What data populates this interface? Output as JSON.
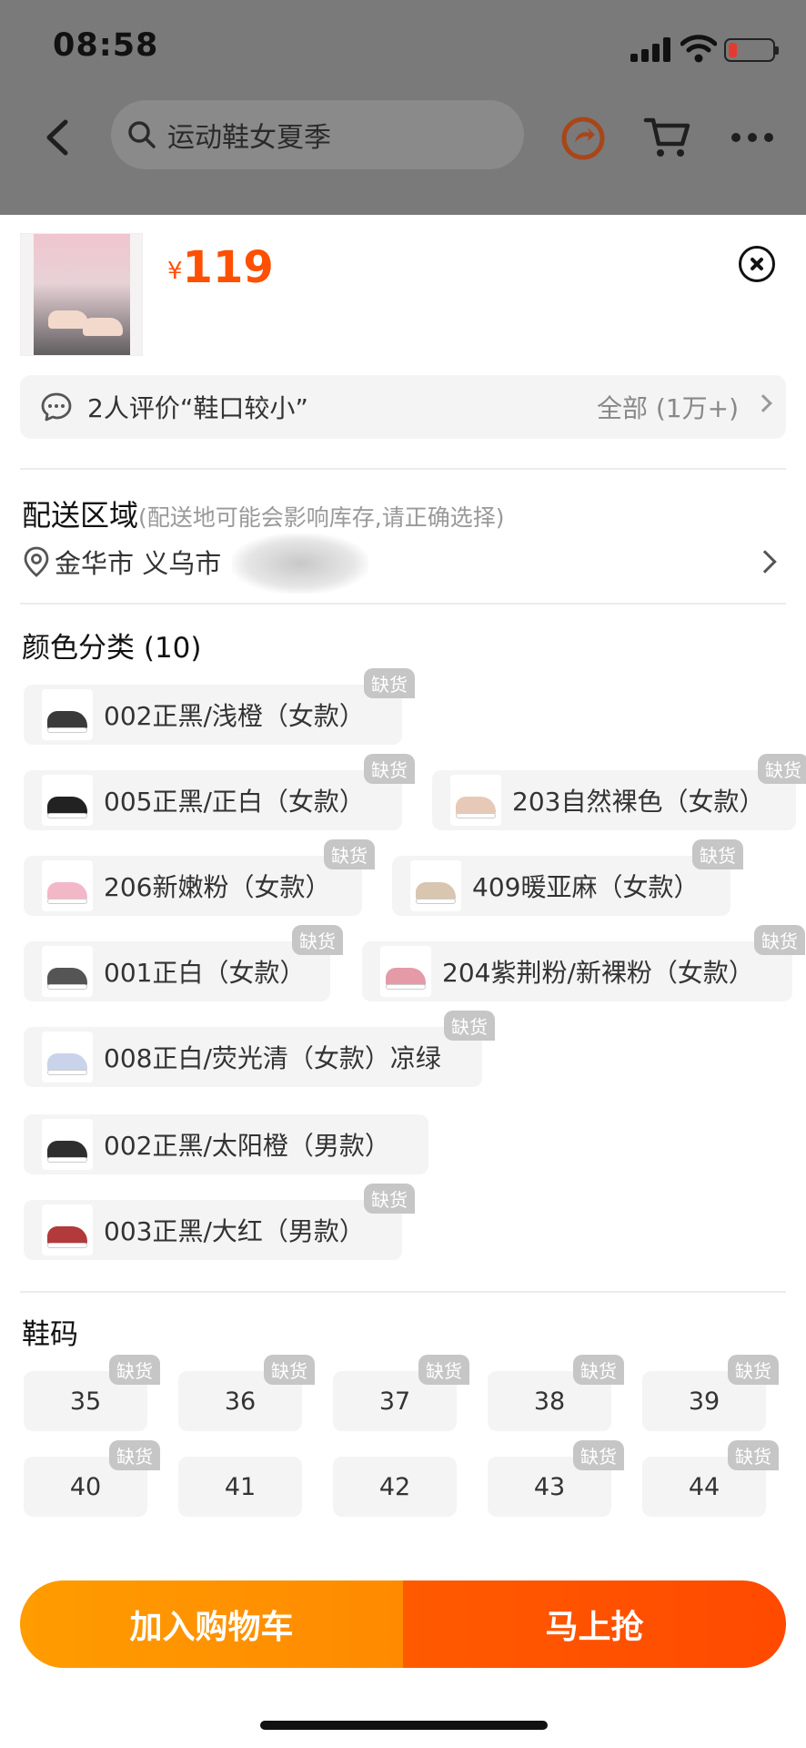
{
  "status": {
    "time": "08:58"
  },
  "nav": {
    "search_placeholder": "运动鞋女夏季"
  },
  "product": {
    "currency": "¥",
    "price": "119"
  },
  "review": {
    "summary": "2人评价“鞋口较小”",
    "all_label": "全部 (1万+)"
  },
  "address": {
    "title": "配送区域",
    "note": "(配送地可能会影响库存,请正确选择)",
    "location": "金华市 义乌市"
  },
  "colors": {
    "title": "颜色分类 (10)",
    "out_of_stock_label": "缺货",
    "items": [
      {
        "label": "002正黑/浅橙（女款）",
        "out_of_stock": true,
        "shoe_color": "#3a3a3a"
      },
      {
        "label": "005正黑/正白（女款）",
        "out_of_stock": true,
        "shoe_color": "#222222"
      },
      {
        "label": "203自然裸色（女款）",
        "out_of_stock": true,
        "shoe_color": "#e7c9b8"
      },
      {
        "label": "206新嫩粉（女款）",
        "out_of_stock": true,
        "shoe_color": "#f3b8c8"
      },
      {
        "label": "409暖亚麻（女款）",
        "out_of_stock": true,
        "shoe_color": "#d9c6b0"
      },
      {
        "label": "001正白（女款）",
        "out_of_stock": true,
        "shoe_color": "#555555"
      },
      {
        "label": "204紫荆粉/新裸粉（女款）",
        "out_of_stock": true,
        "shoe_color": "#e59aa8"
      },
      {
        "label": "008正白/荧光清（女款）凉绿",
        "out_of_stock": true,
        "shoe_color": "#c9d4ea"
      },
      {
        "label": "002正黑/太阳橙（男款）",
        "out_of_stock": false,
        "shoe_color": "#2e2e2e"
      },
      {
        "label": "003正黑/大红（男款）",
        "out_of_stock": true,
        "shoe_color": "#b23a3a"
      }
    ]
  },
  "sizes": {
    "title": "鞋码",
    "items": [
      {
        "label": "35",
        "out_of_stock": true
      },
      {
        "label": "36",
        "out_of_stock": true
      },
      {
        "label": "37",
        "out_of_stock": true
      },
      {
        "label": "38",
        "out_of_stock": true
      },
      {
        "label": "39",
        "out_of_stock": true
      },
      {
        "label": "40",
        "out_of_stock": true
      },
      {
        "label": "41",
        "out_of_stock": false
      },
      {
        "label": "42",
        "out_of_stock": false
      },
      {
        "label": "43",
        "out_of_stock": true
      },
      {
        "label": "44",
        "out_of_stock": true
      }
    ]
  },
  "actions": {
    "add_to_cart": "加入购物车",
    "buy_now": "马上抢"
  },
  "theme": {
    "accent": "#ff4f00",
    "cart_orange": "#ff9000",
    "buy_red": "#ff5000"
  }
}
